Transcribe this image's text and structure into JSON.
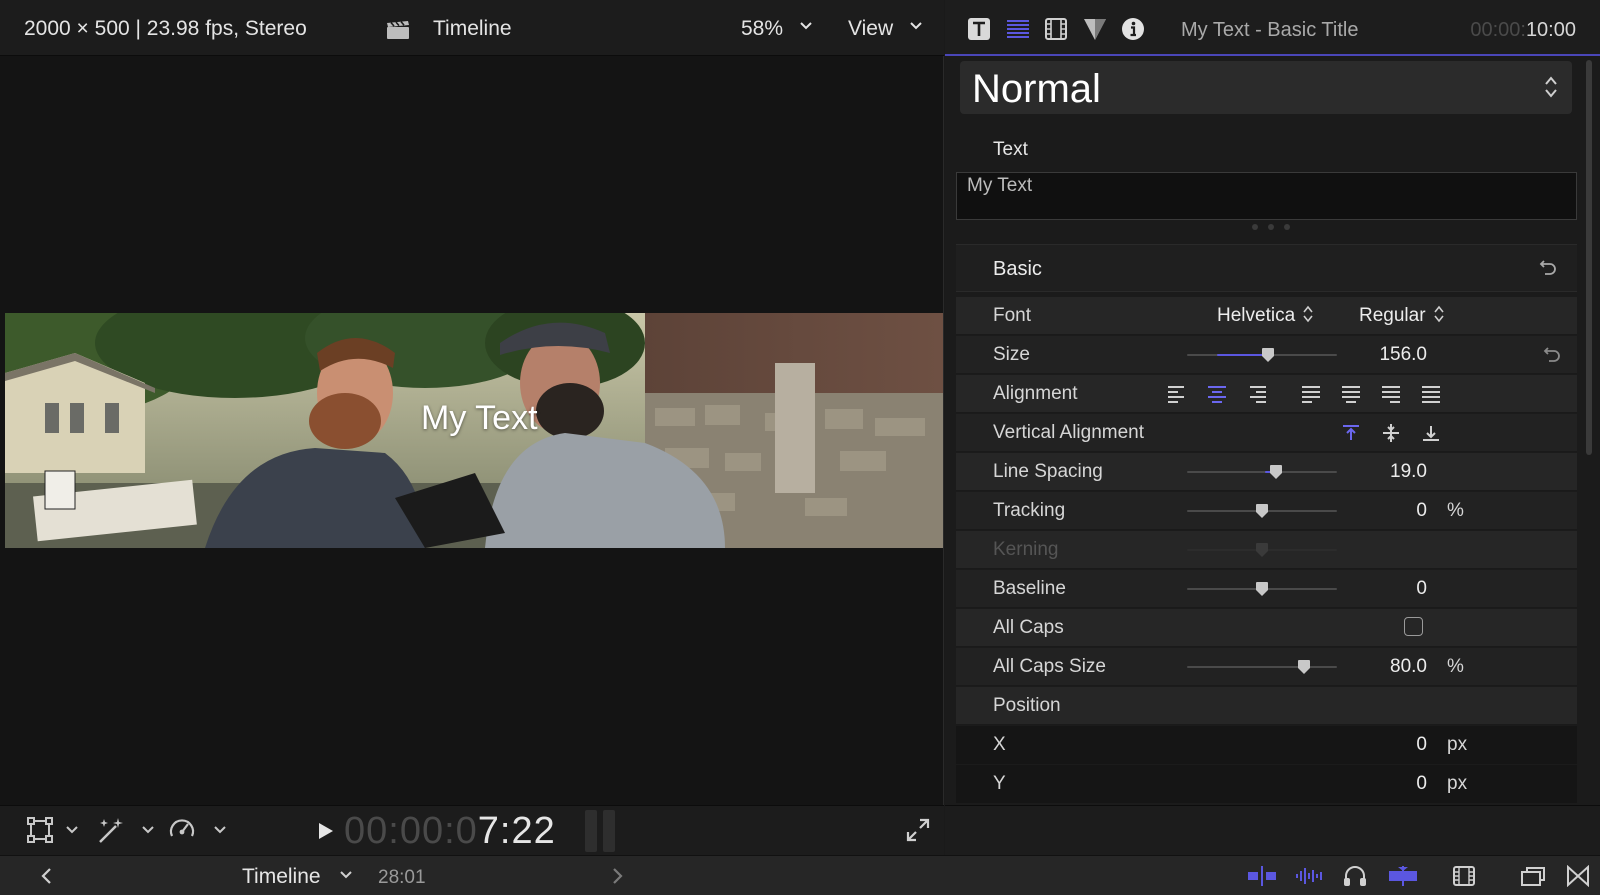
{
  "viewer": {
    "format": "2000 × 500 | 23.98 fps, Stereo",
    "title": "Timeline",
    "zoom": "58%",
    "view_menu": "View",
    "canvas_text": "My Text",
    "timecode_dim": "00:00:0",
    "timecode_lit": "7:22"
  },
  "inspector": {
    "title": "My Text - Basic Title",
    "duration_dim": "00:00:",
    "duration_lit": "10:00",
    "preset": "Normal",
    "text_section_label": "Text",
    "text_value": "My Text",
    "basic_label": "Basic",
    "properties": {
      "font": {
        "label": "Font",
        "family": "Helvetica",
        "style": "Regular"
      },
      "size": {
        "label": "Size",
        "value": "156.0",
        "level": 0.54
      },
      "alignment": {
        "label": "Alignment",
        "selected": "center"
      },
      "vertical_alignment": {
        "label": "Vertical Alignment",
        "selected": "top"
      },
      "line_spacing": {
        "label": "Line Spacing",
        "value": "19.0",
        "level": 0.59
      },
      "tracking": {
        "label": "Tracking",
        "value": "0",
        "unit": "%",
        "level": 0.5
      },
      "kerning": {
        "label": "Kerning",
        "level": 0.5
      },
      "baseline": {
        "label": "Baseline",
        "value": "0",
        "level": 0.5
      },
      "all_caps": {
        "label": "All Caps",
        "checked": false
      },
      "all_caps_size": {
        "label": "All Caps Size",
        "value": "80.0",
        "unit": "%",
        "level": 0.78
      },
      "position": {
        "label": "Position"
      },
      "x": {
        "label": "X",
        "value": "0",
        "unit": "px"
      },
      "y": {
        "label": "Y",
        "value": "0",
        "unit": "px"
      }
    }
  },
  "bottom_bar": {
    "title": "Timeline",
    "duration": "28:01"
  },
  "colors": {
    "accent": "#5b57e0",
    "background": "#141414",
    "panel": "#262626"
  },
  "icons": [
    "clapper-icon",
    "chevron-down-icon",
    "text-inspector-icon",
    "video-inspector-icon",
    "filmstrip-icon",
    "color-icon",
    "info-icon",
    "reset-icon",
    "transform-icon",
    "magic-wand-icon",
    "speed-icon",
    "play-icon",
    "fullscreen-icon",
    "back-icon",
    "forward-icon",
    "audio-waveform-icon",
    "headphones-icon",
    "clip-skimming-icon",
    "snapping-icon",
    "browser-icon",
    "transitions-icon"
  ]
}
